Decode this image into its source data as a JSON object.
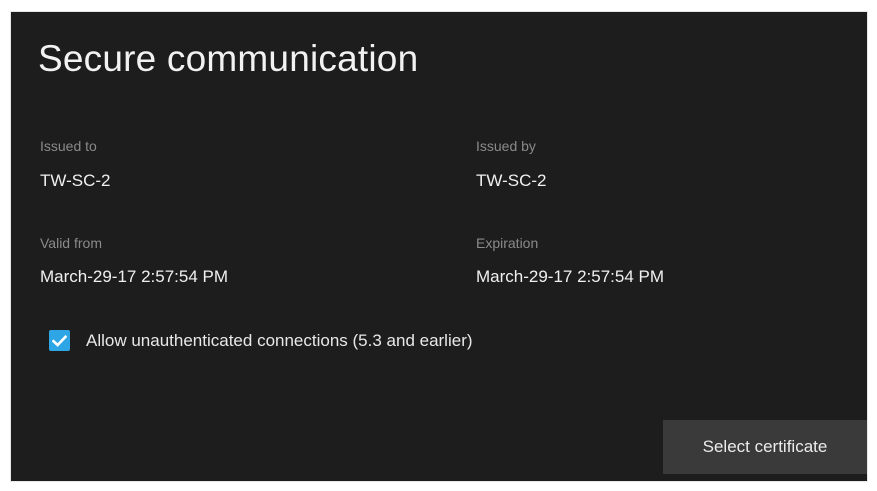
{
  "dialog": {
    "title": "Secure communication"
  },
  "fields": {
    "issued_to_label": "Issued to",
    "issued_to_value": "TW-SC-2",
    "issued_by_label": "Issued by",
    "issued_by_value": "TW-SC-2",
    "valid_from_label": "Valid from",
    "valid_from_value": "March-29-17 2:57:54 PM",
    "expiration_label": "Expiration",
    "expiration_value": "March-29-17 2:57:54 PM"
  },
  "options": {
    "allow_unauth_label": "Allow unauthenticated connections (5.3 and earlier)",
    "allow_unauth_checked": true
  },
  "actions": {
    "select_certificate_label": "Select certificate"
  },
  "colors": {
    "panel_bg": "#1d1d1d",
    "accent": "#2ea6e6",
    "button_bg": "#3a3a3a"
  }
}
